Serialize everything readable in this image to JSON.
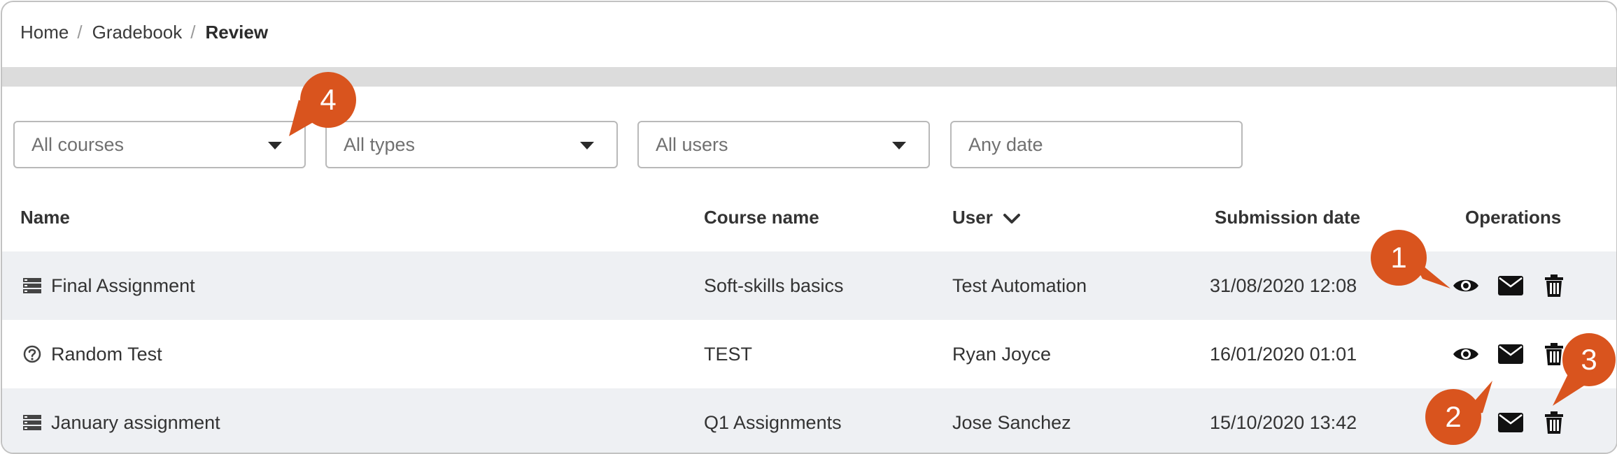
{
  "breadcrumb": {
    "items": [
      "Home",
      "Gradebook"
    ],
    "current": "Review"
  },
  "filters": {
    "courses": "All courses",
    "types": "All types",
    "users": "All users",
    "date_placeholder": "Any date"
  },
  "table": {
    "headers": {
      "name": "Name",
      "course": "Course name",
      "user": "User",
      "date": "Submission date",
      "operations": "Operations"
    },
    "rows": [
      {
        "name": "Final Assignment",
        "type_icon": "assignment-icon",
        "course": "Soft-skills basics",
        "user": "Test Automation",
        "date": "31/08/2020 12:08"
      },
      {
        "name": "Random Test",
        "type_icon": "question-circle-icon",
        "course": "TEST",
        "user": "Ryan Joyce",
        "date": "16/01/2020 01:01"
      },
      {
        "name": "January assignment",
        "type_icon": "assignment-icon",
        "course": "Q1 Assignments",
        "user": "Jose Sanchez",
        "date": "15/10/2020 13:42"
      }
    ]
  },
  "callouts": [
    "1",
    "2",
    "3",
    "4"
  ],
  "colors": {
    "callout": "#d9541e",
    "row_shade": "#eef0f3",
    "band": "#dcdcdc"
  }
}
